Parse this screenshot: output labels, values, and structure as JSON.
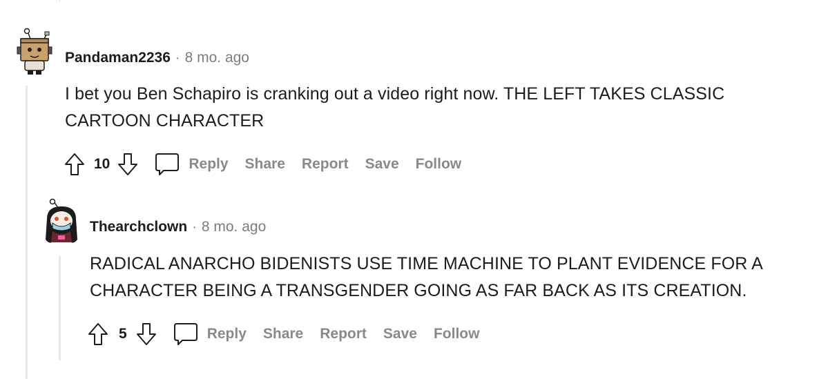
{
  "comments": [
    {
      "username": "Pandaman2236",
      "separator": "·",
      "time": "8 mo. ago",
      "body_line1": "I bet you Ben Schapiro is cranking out a video right now. THE LEFT TAKES CLASSIC",
      "body_line2": "CARTOON CHARACTER",
      "score": "10",
      "avatar_icon": "box-robot-avatar-icon"
    },
    {
      "username": "Thearchclown",
      "separator": "·",
      "time": "8 mo. ago",
      "body_line1": "RADICAL ANARCHO BIDENISTS USE TIME MACHINE TO PLANT EVIDENCE FOR A",
      "body_line2": "CHARACTER BEING A TRANSGENDER GOING AS FAR BACK AS ITS CREATION.",
      "score": "5",
      "avatar_icon": "masked-snoo-avatar-icon"
    }
  ],
  "actions": {
    "reply": "Reply",
    "share": "Share",
    "report": "Report",
    "save": "Save",
    "follow": "Follow"
  },
  "colors": {
    "text": "#1c1c1c",
    "meta": "#7c7c7c",
    "action": "#878a8c",
    "thread_line": "#e8e8e8"
  }
}
